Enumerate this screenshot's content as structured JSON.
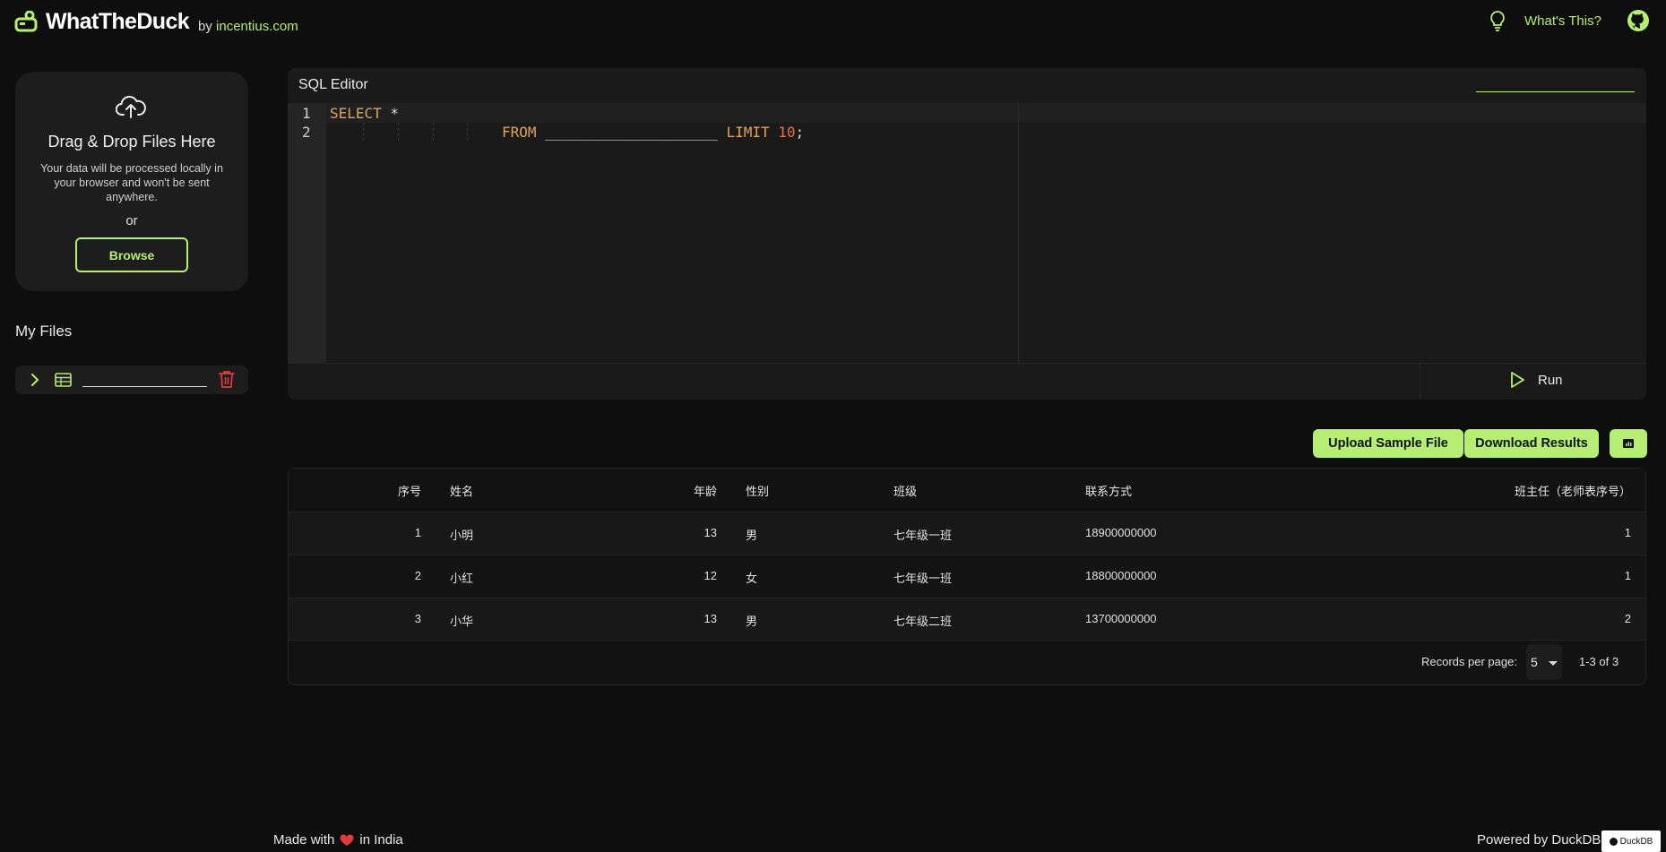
{
  "header": {
    "brand": "WhatTheDuck",
    "by_prefix": "by ",
    "by_link": "incentius.com",
    "whats_this": "What's This?",
    "icons": [
      "logo-icon",
      "lightbulb-icon",
      "github-icon"
    ]
  },
  "upload": {
    "title": "Drag & Drop Files Here",
    "description": "Your data will be processed locally in your browser and won't be sent anywhere.",
    "or": "or",
    "browse": "Browse"
  },
  "files": {
    "heading": "My Files",
    "items": [
      {
        "name": ""
      }
    ]
  },
  "editor": {
    "title": "SQL Editor",
    "line_numbers": [
      "1",
      "2"
    ],
    "line1": {
      "keyword": "SELECT",
      "rest": " *"
    },
    "line2": {
      "from": "FROM",
      "table": "____________________",
      "limit": "LIMIT",
      "n": "10",
      "end": ";"
    },
    "run_label": "Run"
  },
  "actions": {
    "upload_sample": "Upload Sample File",
    "download_results": "Download Results"
  },
  "table": {
    "columns": [
      "序号",
      "姓名",
      "年龄",
      "性别",
      "班级",
      "联系方式",
      "班主任（老师表序号）"
    ],
    "rows": [
      [
        "1",
        "小明",
        "13",
        "男",
        "七年级一班",
        "18900000000",
        "1"
      ],
      [
        "2",
        "小红",
        "12",
        "女",
        "七年级一班",
        "18800000000",
        "1"
      ],
      [
        "3",
        "小华",
        "13",
        "男",
        "七年级二班",
        "13700000000",
        "2"
      ]
    ]
  },
  "pagination": {
    "label": "Records per page:",
    "per_page": "5",
    "range": "1-3 of 3"
  },
  "footer": {
    "made_with": "Made with",
    "in_india": "in India",
    "powered_by": "Powered by DuckDB",
    "badge": "DuckDB"
  },
  "colors": {
    "accent": "#b5ee72",
    "background": "#0e0e0e",
    "card": "#1d1d1d",
    "danger": "#e03a3a"
  }
}
